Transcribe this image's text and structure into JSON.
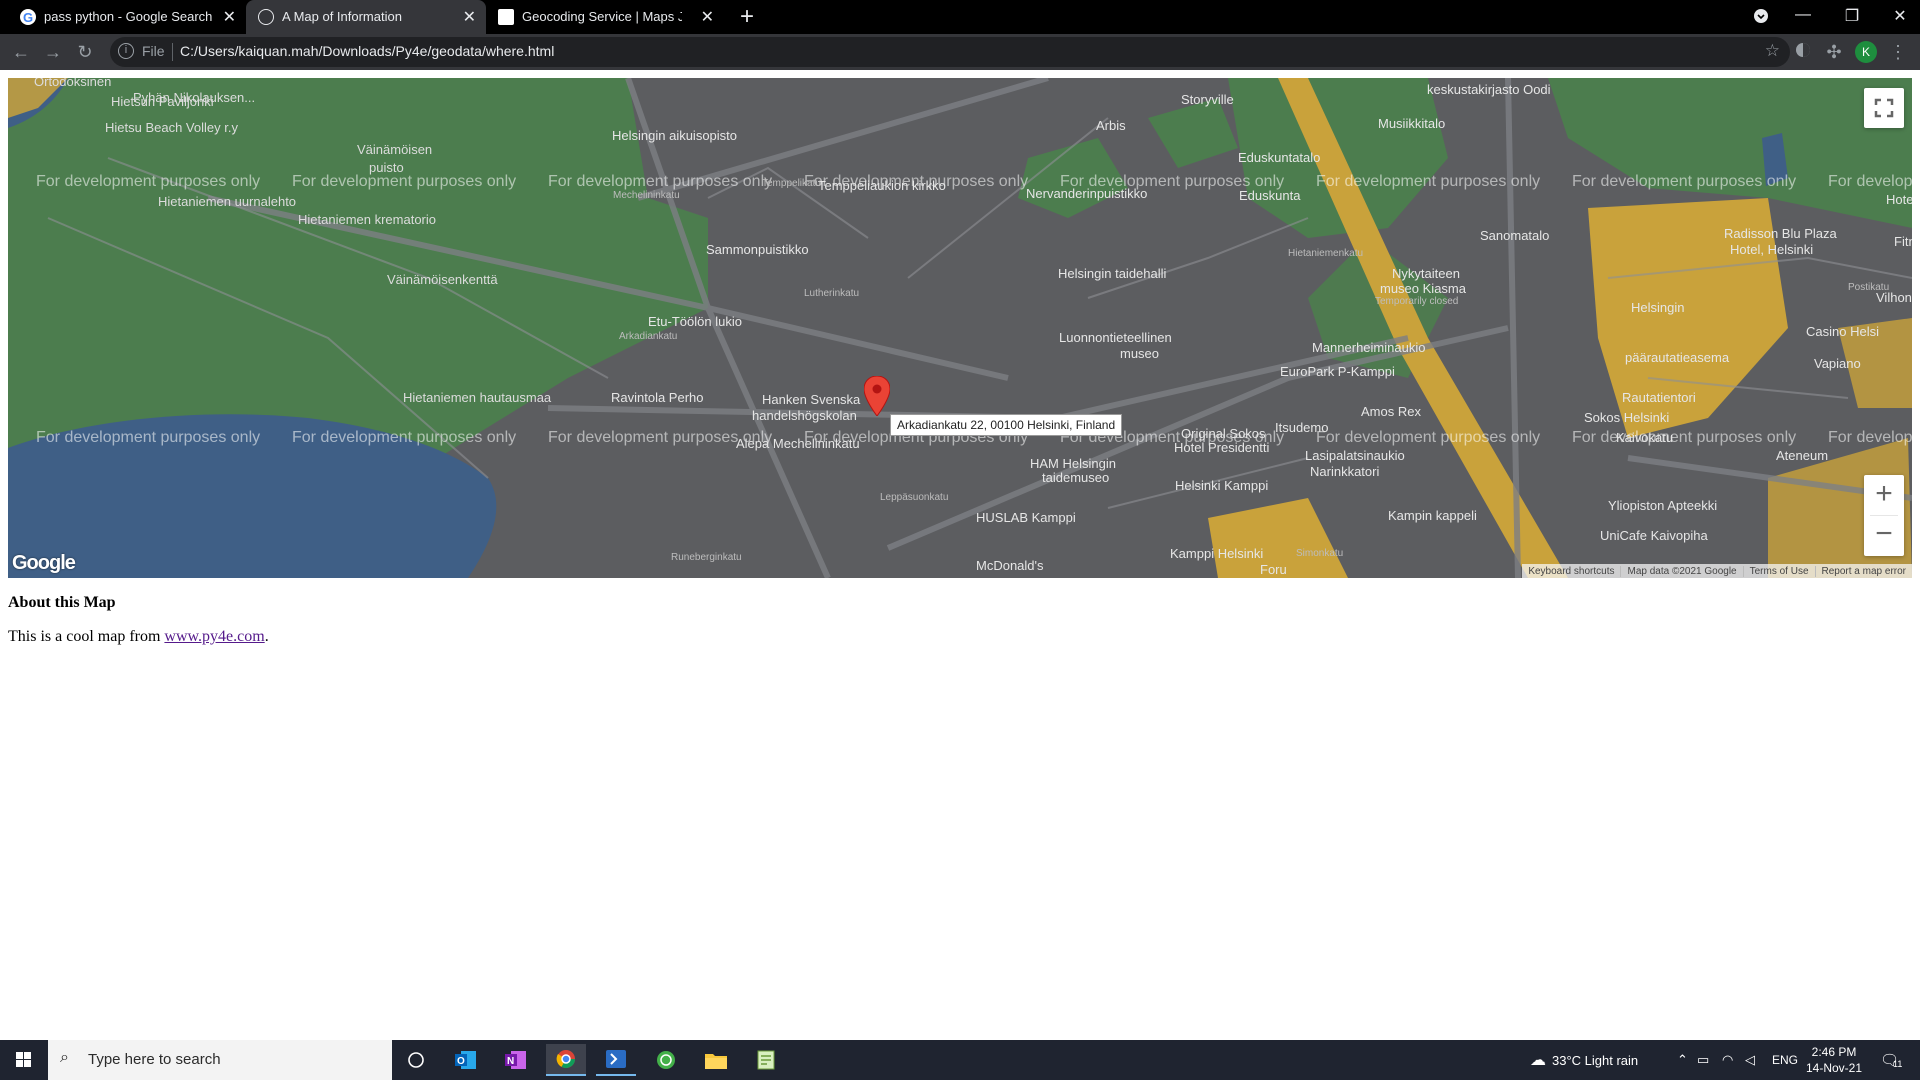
{
  "browser": {
    "tabs": [
      {
        "title": "pass python - Google Search",
        "active": false
      },
      {
        "title": "A Map of Information",
        "active": true
      },
      {
        "title": "Geocoding Service | Maps JavaS",
        "active": false
      }
    ],
    "url_scheme": "File",
    "url": "C:/Users/kaiquan.mah/Downloads/Py4e/geodata/where.html",
    "profile_initial": "K"
  },
  "map": {
    "watermark": "For development purposes only",
    "marker_info": "Arkadiankatu 22, 00100 Helsinki, Finland",
    "logo_text": "Google",
    "attribution": [
      "Keyboard shortcuts",
      "Map data ©2021 Google",
      "Terms of Use",
      "Report a map error"
    ],
    "zoom_in": "+",
    "zoom_out": "−",
    "labels": [
      {
        "text": "Ortodoksinen",
        "cls": "dark"
      },
      {
        "text": "Pyhän Nikolauksen...",
        "cls": "dark"
      },
      {
        "text": "Hietsun Paviljonki",
        "cls": "dark"
      },
      {
        "text": "Hietsu Beach Volley r.y",
        "cls": "dark"
      },
      {
        "text": "Väinämöisen",
        "cls": "dark"
      },
      {
        "text": "puisto",
        "cls": "dark"
      },
      {
        "text": "Hietaniemen uurnalehto",
        "cls": "dark"
      },
      {
        "text": "Hietaniemen krematorio",
        "cls": "dark"
      },
      {
        "text": "Väinämöisenkenttä",
        "cls": "dark"
      },
      {
        "text": "Hietaniemen hautausmaa",
        "cls": "dark"
      },
      {
        "text": "Helsingin aikuisopisto",
        "cls": "light"
      },
      {
        "text": "Temppeliaukion kirkko",
        "cls": "light"
      },
      {
        "text": "Sammonpuistikko",
        "cls": "light"
      },
      {
        "text": "Etu-Töölön lukio",
        "cls": "light"
      },
      {
        "text": "Ravintola Perho",
        "cls": "light"
      },
      {
        "text": "Hanken Svenska",
        "cls": "light"
      },
      {
        "text": "handelshögskolan",
        "cls": "light"
      },
      {
        "text": "Alepa Mechelininkatu",
        "cls": "light"
      },
      {
        "text": "Arbis",
        "cls": "light"
      },
      {
        "text": "Storyville",
        "cls": "light"
      },
      {
        "text": "Nervanderinpuistikko",
        "cls": "light"
      },
      {
        "text": "Helsingin taidehalli",
        "cls": "light"
      },
      {
        "text": "Luonnontieteellinen",
        "cls": "light"
      },
      {
        "text": "museo",
        "cls": "light"
      },
      {
        "text": "HAM Helsingin",
        "cls": "light"
      },
      {
        "text": "taidemuseo",
        "cls": "light"
      },
      {
        "text": "HUSLAB Kamppi",
        "cls": "light"
      },
      {
        "text": "McDonald's",
        "cls": "light"
      },
      {
        "text": "Eduskuntatalo",
        "cls": "light"
      },
      {
        "text": "Eduskunta",
        "cls": "light"
      },
      {
        "text": "Musiikkitalo",
        "cls": "light"
      },
      {
        "text": "keskustakirjasto Oodi",
        "cls": "light"
      },
      {
        "text": "Sanomatalo",
        "cls": "light"
      },
      {
        "text": "Nykytaiteen",
        "cls": "light"
      },
      {
        "text": "museo Kiasma",
        "cls": "light"
      },
      {
        "text": "Temporarily closed",
        "cls": "light"
      },
      {
        "text": "Mannerheiminaukio",
        "cls": "light"
      },
      {
        "text": "EuroPark P-Kamppi",
        "cls": "light"
      },
      {
        "text": "Itsudemo",
        "cls": "light"
      },
      {
        "text": "Amos Rex",
        "cls": "light"
      },
      {
        "text": "Original Sokos",
        "cls": "light"
      },
      {
        "text": "Hotel Presidentti",
        "cls": "light"
      },
      {
        "text": "Helsinki Kamppi",
        "cls": "light"
      },
      {
        "text": "Lasipalatsinaukio",
        "cls": "light"
      },
      {
        "text": "Narinkkatori",
        "cls": "light"
      },
      {
        "text": "Kampin kappeli",
        "cls": "light"
      },
      {
        "text": "Kamppi Helsinki",
        "cls": "light"
      },
      {
        "text": "Helsingin",
        "cls": "light"
      },
      {
        "text": "päärautatieasema",
        "cls": "light"
      },
      {
        "text": "Rautatientori",
        "cls": "light"
      },
      {
        "text": "Sokos Helsinki",
        "cls": "light"
      },
      {
        "text": "Kaivokatu",
        "cls": "light"
      },
      {
        "text": "Ateneum",
        "cls": "light"
      },
      {
        "text": "Yliopiston Apteekki",
        "cls": "light"
      },
      {
        "text": "UniCafe Kaivopiha",
        "cls": "light"
      },
      {
        "text": "Radisson Blu Plaza",
        "cls": "light"
      },
      {
        "text": "Hotel, Helsinki",
        "cls": "light"
      },
      {
        "text": "Casino Helsi",
        "cls": "light"
      },
      {
        "text": "Vapiano",
        "cls": "light"
      },
      {
        "text": "Vilhonl",
        "cls": "light"
      },
      {
        "text": "Fitne",
        "cls": "light"
      },
      {
        "text": "Hotel A",
        "cls": "light"
      },
      {
        "text": "Simonkatu",
        "cls": "light"
      },
      {
        "text": "Foru",
        "cls": "light"
      },
      {
        "text": "Mechelininkatu",
        "cls": "light"
      },
      {
        "text": "Arkadiankatu",
        "cls": "light"
      },
      {
        "text": "Lutherinkatu",
        "cls": "light"
      },
      {
        "text": "Temppelikatu",
        "cls": "light"
      },
      {
        "text": "Postikatu",
        "cls": "light"
      },
      {
        "text": "Hietaniemenkatu",
        "cls": "light"
      },
      {
        "text": "Leppäsuonkatu",
        "cls": "light"
      },
      {
        "text": "Runeberginkatu",
        "cls": "light"
      }
    ]
  },
  "page": {
    "heading": "About this Map",
    "text_prefix": "This is a cool map from ",
    "link_text": "www.py4e.com",
    "text_suffix": "."
  },
  "taskbar": {
    "search_placeholder": "Type here to search",
    "weather": "33°C  Light rain",
    "lang": "ENG",
    "time": "2:46 PM",
    "date": "14-Nov-21",
    "notif_count": "11"
  },
  "colors": {
    "park": "#4c7d4e",
    "water": "#3f5f86",
    "urban": "#5c5d60",
    "yellow": "#c9a23b",
    "marker": "#ea4335"
  }
}
